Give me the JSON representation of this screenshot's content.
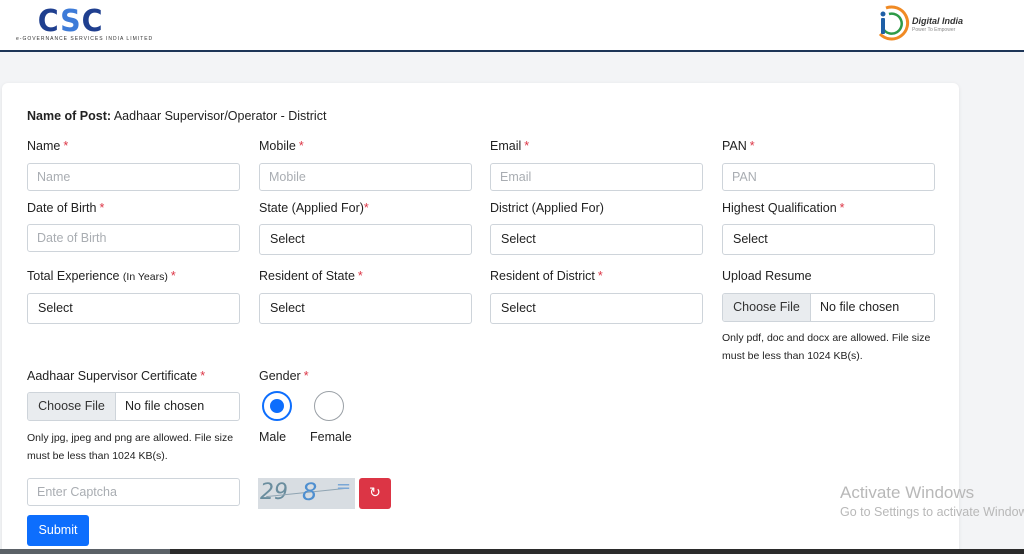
{
  "header": {
    "left_logo": {
      "text": "CSC",
      "tagline": "e-GOVERNANCE SERVICES INDIA LIMITED"
    },
    "right_logo": {
      "text": "Digital India",
      "sub": "Power To Empower"
    }
  },
  "form": {
    "post_label": "Name of Post:",
    "post_value": "Aadhaar Supervisor/Operator - District",
    "name": {
      "label": "Name",
      "placeholder": "Name"
    },
    "mobile": {
      "label": "Mobile",
      "placeholder": "Mobile"
    },
    "email": {
      "label": "Email",
      "placeholder": "Email"
    },
    "pan": {
      "label": "PAN",
      "placeholder": "PAN"
    },
    "dob": {
      "label": "Date of Birth",
      "placeholder": "Date of Birth"
    },
    "state": {
      "label": "State (Applied For)",
      "value": "Select"
    },
    "district": {
      "label": "District (Applied For)",
      "value": "Select"
    },
    "qualification": {
      "label": "Highest Qualification",
      "value": "Select"
    },
    "experience": {
      "label": "Total Experience",
      "label_small": "(In Years)",
      "value": "Select"
    },
    "resident_state": {
      "label": "Resident of State",
      "value": "Select"
    },
    "resident_district": {
      "label": "Resident of District",
      "value": "Select"
    },
    "resume": {
      "label": "Upload Resume",
      "button": "Choose File",
      "status": "No file chosen",
      "hint": "Only pdf, doc and docx are allowed. File size must be less than 1024 KB(s)."
    },
    "certificate": {
      "label": "Aadhaar Supervisor Certificate",
      "button": "Choose File",
      "status": "No file chosen",
      "hint": "Only jpg, jpeg and png are allowed. File size must be less than 1024 KB(s)."
    },
    "gender": {
      "label": "Gender",
      "options": [
        {
          "label": "Male",
          "selected": true
        },
        {
          "label": "Female",
          "selected": false
        }
      ]
    },
    "captcha": {
      "placeholder": "Enter Captcha",
      "image_text": "29 8"
    },
    "required_mark": "*",
    "submit": "Submit"
  },
  "watermark": {
    "title": "Activate Windows",
    "sub": "Go to Settings to activate Windows."
  },
  "colors": {
    "primary": "#0d6efd",
    "danger": "#dc3545",
    "header_border": "#1d3557"
  }
}
